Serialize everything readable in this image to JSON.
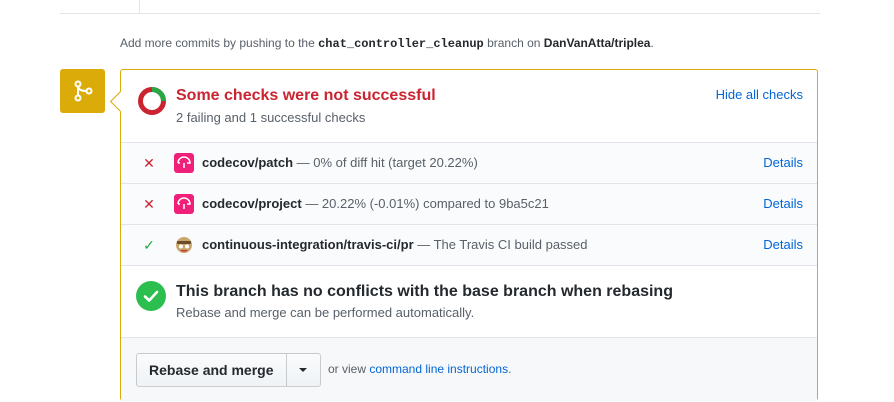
{
  "push_note": {
    "prefix": "Add more commits by pushing to the ",
    "branch": "chat_controller_cleanup",
    "middle": " branch on ",
    "repo": "DanVanAtta/triplea",
    "suffix": "."
  },
  "checks": {
    "title": "Some checks were not successful",
    "subtitle": "2 failing and 1 successful checks",
    "hide_label": "Hide all checks",
    "items": [
      {
        "status": "fail",
        "icon": "codecov-icon",
        "name": "codecov/patch",
        "description": " — 0% of diff hit (target 20.22%)",
        "details": "Details"
      },
      {
        "status": "fail",
        "icon": "codecov-icon",
        "name": "codecov/project",
        "description": " — 20.22% (-0.01%) compared to 9ba5c21",
        "details": "Details"
      },
      {
        "status": "success",
        "icon": "travis-ci-icon",
        "name": "continuous-integration/travis-ci/pr",
        "description": " — The Travis CI build passed",
        "details": "Details"
      }
    ]
  },
  "conflicts": {
    "title": "This branch has no conflicts with the base branch when rebasing",
    "subtitle": "Rebase and merge can be performed automatically."
  },
  "merge": {
    "button_label": "Rebase and merge",
    "or_view": "or view ",
    "cli_link": "command line instructions",
    "period": "."
  },
  "colors": {
    "warning": "#dbab09",
    "fail": "#cb2431",
    "success": "#28a745",
    "link": "#0366d6",
    "codecov": "#f01f7a"
  }
}
